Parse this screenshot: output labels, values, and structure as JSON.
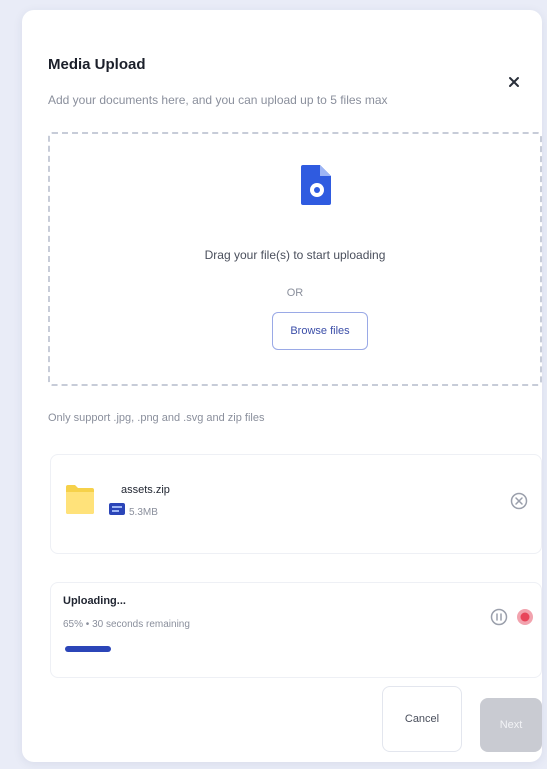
{
  "modal": {
    "title": "Media Upload",
    "subtitle": "Add your documents here, and you can upload up to 5 files max"
  },
  "dropzone": {
    "drag_text": "Drag your file(s) to start uploading",
    "or_text": "OR",
    "browse_label": "Browse files",
    "icon": "document-upload-icon"
  },
  "support_text": "Only support .jpg, .png and .svg and zip files",
  "files": [
    {
      "name": "assets.zip",
      "size": "5.3MB",
      "icon": "folder-zip-icon"
    }
  ],
  "upload": {
    "status": "Uploading...",
    "detail": "65% • 30 seconds remaining",
    "progress_percent": 10
  },
  "footer": {
    "cancel_label": "Cancel",
    "next_label": "Next"
  },
  "colors": {
    "accent": "#2b45b8",
    "danger": "#e8455a",
    "background": "#e9ecf7"
  }
}
